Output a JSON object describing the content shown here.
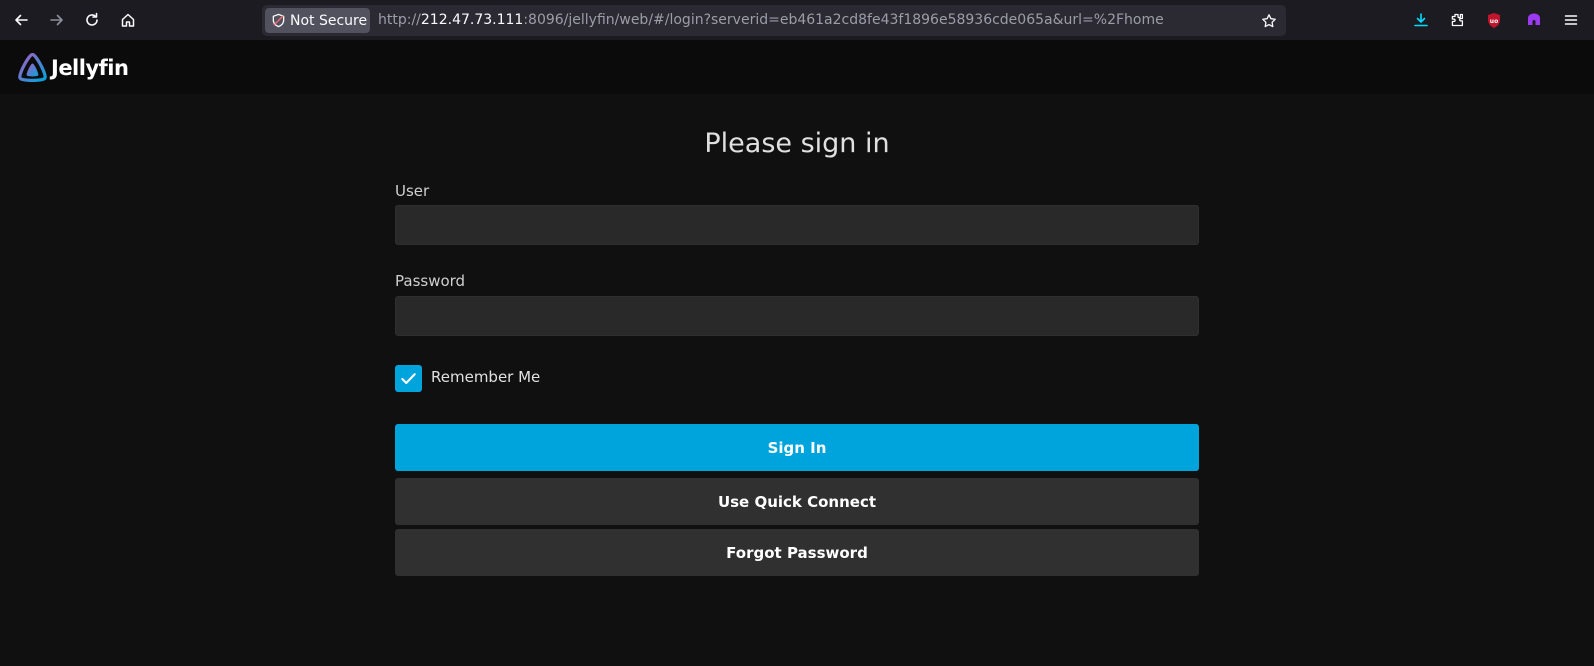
{
  "browser": {
    "security_label": "Not Secure",
    "url_prefix": "http://",
    "url_host": "212.47.73.111",
    "url_rest": ":8096/jellyfin/web/#/login?serverid=eb461a2cd8fe43f1896e58936cde065a&url=%2Fhome",
    "icons": [
      "back-icon",
      "forward-icon",
      "reload-icon",
      "home-icon",
      "shield-icon",
      "bookmark-star-icon",
      "downloads-icon",
      "extensions-icon",
      "ublock-icon",
      "extension-icon",
      "menu-icon"
    ],
    "accent_download": "#00ddff",
    "ublock_color": "#c0152c",
    "extension_color": "#9b3af0"
  },
  "app": {
    "logo_text": "Jellyfin"
  },
  "login": {
    "title": "Please sign in",
    "user_label": "User",
    "user_value": "",
    "password_label": "Password",
    "password_value": "",
    "remember_label": "Remember Me",
    "remember_checked": true,
    "sign_in_label": "Sign In",
    "quick_connect_label": "Use Quick Connect",
    "forgot_password_label": "Forgot Password"
  },
  "colors": {
    "primary": "#00a4dc",
    "background": "#101010",
    "header": "#0b0b0b",
    "secondary_button": "#303030"
  }
}
